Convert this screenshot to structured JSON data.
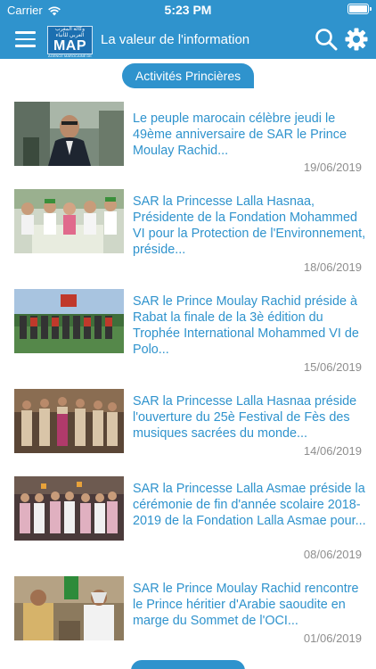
{
  "statusbar": {
    "carrier": "Carrier",
    "time": "5:23 PM",
    "wifi_icon": "wifi-icon",
    "battery_icon": "battery-icon"
  },
  "navbar": {
    "menu_icon": "hamburger-menu-icon",
    "logo": {
      "text": "MAP",
      "arabic": "وكالة المغرب العربي للأنباء",
      "sub": "AGENCE MAROCAINE DE PRESSE"
    },
    "title": "La valeur de l'information",
    "search_icon": "search-icon",
    "settings_icon": "gear-icon"
  },
  "category": {
    "label": "Activités Princières"
  },
  "articles": [
    {
      "title": "Le peuple marocain célèbre jeudi le 49ème anniversaire de SAR le Prince Moulay Rachid...",
      "date": "19/06/2019"
    },
    {
      "title": "SAR la Princesse Lalla Hasnaa, Présidente de la Fondation Mohammed VI pour la Protection de l'Environnement, préside...",
      "date": "18/06/2019"
    },
    {
      "title": "SAR le Prince Moulay Rachid préside à Rabat la finale de la 3è édition du Trophée International Mohammed VI de Polo...",
      "date": "15/06/2019"
    },
    {
      "title": "SAR la Princesse Lalla Hasnaa préside l'ouverture du 25è Festival de Fès des musiques sacrées du monde...",
      "date": "14/06/2019"
    },
    {
      "title": "SAR la Princesse Lalla Asmae préside la cérémonie de fin d'année scolaire 2018-2019 de la Fondation Lalla Asmae pour...",
      "date": "08/06/2019"
    },
    {
      "title": "SAR le Prince Moulay Rachid rencontre le Prince héritier d'Arabie saoudite en marge du Sommet de l'OCI...",
      "date": "01/06/2019"
    }
  ],
  "colors": {
    "accent": "#2f93cd",
    "date": "#8e8e8e",
    "background": "#ffffff"
  }
}
